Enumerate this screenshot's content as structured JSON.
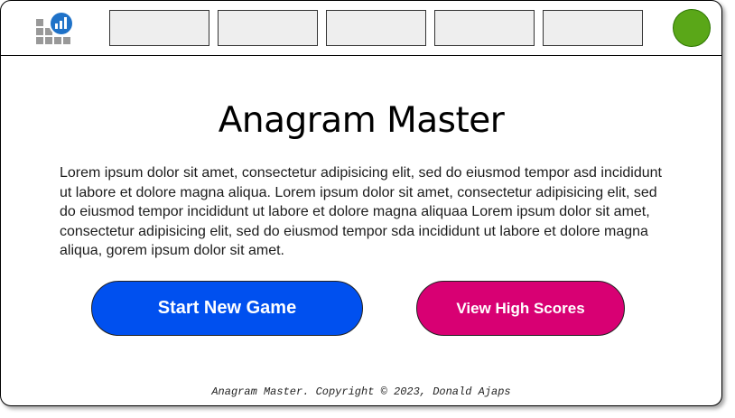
{
  "header": {
    "logo_icon": "bar-chart-grid-logo",
    "nav_items": [
      "",
      "",
      "",
      "",
      ""
    ],
    "avatar_color": "#5aa718"
  },
  "main": {
    "title": "Anagram Master",
    "description": "Lorem ipsum dolor sit amet, consectetur adipisicing elit, sed do eiusmod tempor asd incididunt ut labore et dolore magna aliqua. Lorem ipsum dolor sit amet, consectetur adipisicing elit, sed do eiusmod tempor incididunt ut labore et dolore magna aliquaa Lorem ipsum dolor sit amet, consectetur adipisicing elit, sed do eiusmod tempor sda incididunt ut labore et dolore magna aliqua, gorem ipsum dolor sit amet.",
    "start_button_label": "Start New Game",
    "scores_button_label": "View High Scores"
  },
  "colors": {
    "start_button": "#0050ef",
    "scores_button": "#d80073",
    "nav_box": "#eeeeee"
  },
  "footer": {
    "text": "Anagram Master. Copyright © 2023, Donald Ajaps"
  }
}
